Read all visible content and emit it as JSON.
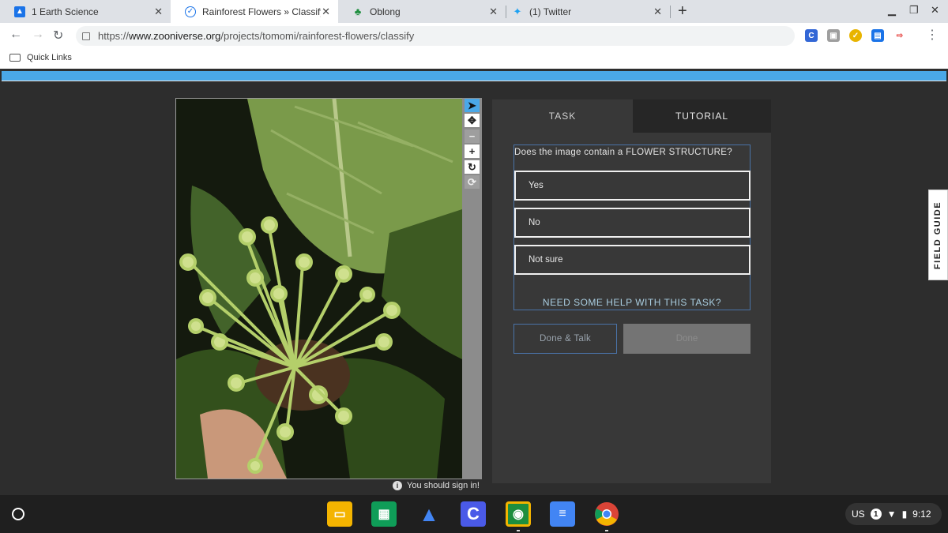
{
  "browser": {
    "tabs": [
      {
        "title": "1 Earth Science",
        "icon": "classroom-icon"
      },
      {
        "title": "Rainforest Flowers » Classify — Z",
        "icon": "zooniverse-icon"
      },
      {
        "title": "Oblong",
        "icon": "oblong-icon"
      },
      {
        "title": "(1) Twitter",
        "icon": "twitter-icon"
      }
    ],
    "url_prefix": "https://",
    "url_host": "www.zooniverse.org",
    "url_path": "/projects/tomomi/rainforest-flowers/classify",
    "bookmarks": [
      {
        "label": "Quick Links"
      }
    ]
  },
  "tools": [
    "pointer-icon",
    "move-icon",
    "zoom-out-icon",
    "zoom-in-icon",
    "rotate-icon",
    "reset-icon"
  ],
  "notice": {
    "text": "You should sign in!"
  },
  "panel": {
    "tabs": [
      {
        "label": "TASK"
      },
      {
        "label": "TUTORIAL"
      }
    ],
    "question": "Does the image contain a FLOWER STRUCTURE?",
    "answers": [
      {
        "label": "Yes"
      },
      {
        "label": "No"
      },
      {
        "label": "Not sure"
      }
    ],
    "help_label": "NEED SOME HELP WITH THIS TASK?",
    "done_talk_label": "Done & Talk",
    "done_label": "Done"
  },
  "field_guide": {
    "label": "FIELD GUIDE"
  },
  "shelf": {
    "apps": [
      "slides-icon",
      "sheets-icon",
      "drive-icon",
      "coggle-icon",
      "classroom-icon",
      "docs-icon",
      "chrome-icon"
    ],
    "status": {
      "locale": "US",
      "notifications": "1",
      "time": "9:12"
    }
  },
  "colors": {
    "accent": "#4aa8e8",
    "panel": "#383838",
    "page": "#2d2d2d",
    "answer_border": "#f0f0f0"
  }
}
